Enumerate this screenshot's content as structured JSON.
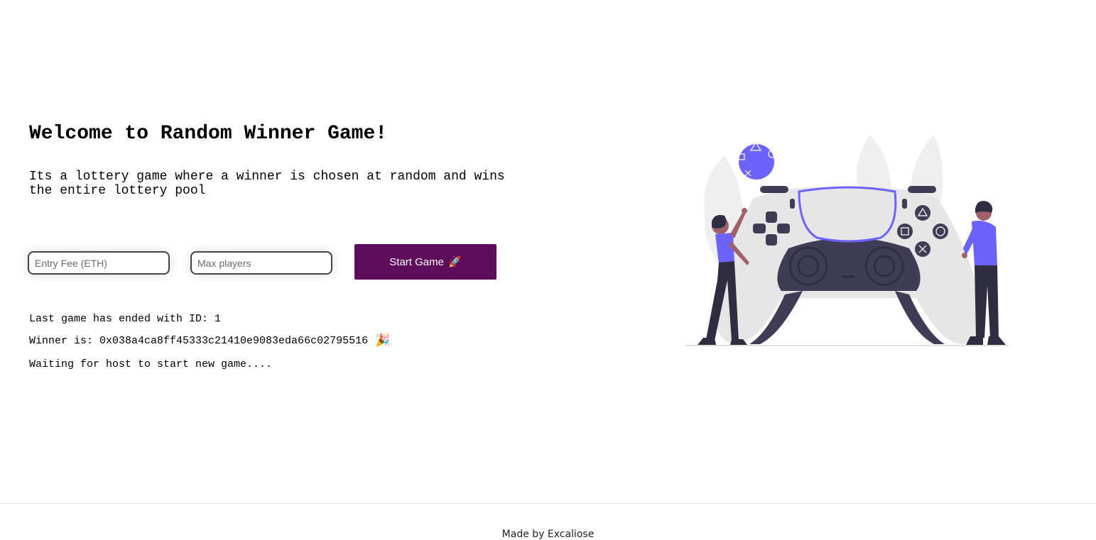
{
  "hero": {
    "title": "Welcome to Random Winner Game!",
    "description": "Its a lottery game where a winner is chosen at random and wins the entire lottery pool"
  },
  "form": {
    "entry_fee_placeholder": "Entry Fee (ETH)",
    "entry_fee_value": "",
    "max_players_placeholder": "Max players",
    "max_players_value": "",
    "start_button_label": "Start Game",
    "start_button_icon": "🚀",
    "start_button_color": "#5e0b5c"
  },
  "status": {
    "last_game": "Last game has ended with ID: 1",
    "winner": "Winner is: 0x038a4ca8ff45333c21410e9083eda66c02795516",
    "winner_icon": "🎉",
    "waiting": "Waiting for host to start new game...."
  },
  "illustration": {
    "name": "game-controller-illustration",
    "accent_color": "#6c63ff"
  },
  "footer": {
    "text": "Made by Excaliose"
  }
}
